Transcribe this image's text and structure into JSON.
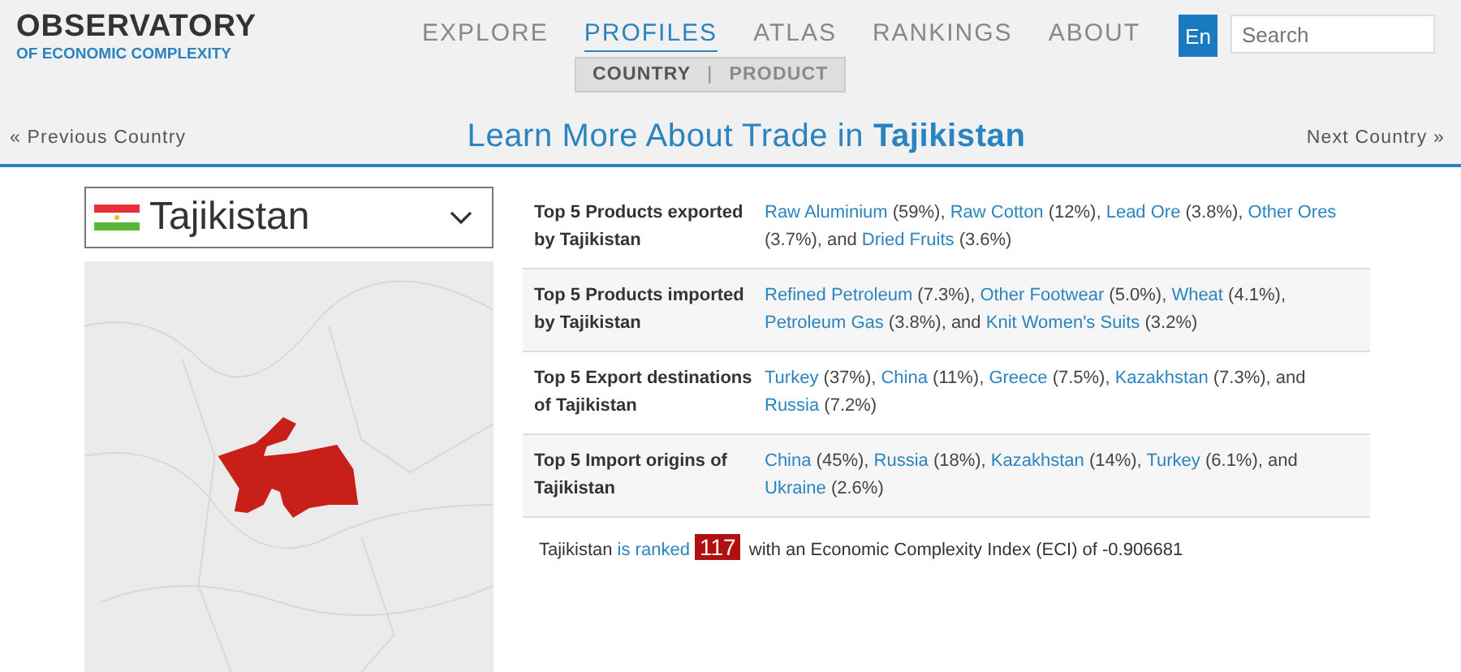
{
  "logo": {
    "title": "OBSERVATORY",
    "subtitle": "OF ECONOMIC COMPLEXITY"
  },
  "nav": [
    {
      "label": "EXPLORE",
      "selected": false
    },
    {
      "label": "PROFILES",
      "selected": true
    },
    {
      "label": "ATLAS",
      "selected": false
    },
    {
      "label": "RANKINGS",
      "selected": false
    },
    {
      "label": "ABOUT",
      "selected": false
    }
  ],
  "subnav": {
    "items": [
      {
        "label": "COUNTRY",
        "selected": true
      },
      {
        "label": "PRODUCT",
        "selected": false
      }
    ],
    "separator": "|"
  },
  "language": "En",
  "search": {
    "placeholder": "Search"
  },
  "prev": "« Previous Country",
  "next": "Next Country »",
  "heading": {
    "text": "Learn More About Trade in ",
    "country": "Tajikistan"
  },
  "country_select": {
    "value": "Tajikistan"
  },
  "rows": [
    {
      "label": "Top 5 Products exported by Tajikistan",
      "parts": [
        {
          "text": "Raw Aluminium",
          "kind": "link"
        },
        {
          "text": " (59%), ",
          "kind": "text"
        },
        {
          "text": "Raw Cotton",
          "kind": "link"
        },
        {
          "text": " (12%), ",
          "kind": "text"
        },
        {
          "text": "Lead Ore",
          "kind": "link"
        },
        {
          "text": " (3.8%), ",
          "kind": "text"
        },
        {
          "text": "Other Ores",
          "kind": "link"
        },
        {
          "text": " (3.7%), and ",
          "kind": "text"
        },
        {
          "text": "Dried Fruits",
          "kind": "link"
        },
        {
          "text": " (3.6%)",
          "kind": "text"
        }
      ]
    },
    {
      "label": "Top 5 Products imported by Tajikistan",
      "parts": [
        {
          "text": "Refined Petroleum",
          "kind": "link"
        },
        {
          "text": " (7.3%), ",
          "kind": "text"
        },
        {
          "text": "Other Footwear",
          "kind": "link"
        },
        {
          "text": " (5.0%), ",
          "kind": "text"
        },
        {
          "text": "Wheat",
          "kind": "link"
        },
        {
          "text": " (4.1%), ",
          "kind": "text"
        },
        {
          "text": "Petroleum Gas",
          "kind": "link"
        },
        {
          "text": " (3.8%), and ",
          "kind": "text"
        },
        {
          "text": "Knit Women's Suits",
          "kind": "link"
        },
        {
          "text": " (3.2%)",
          "kind": "text"
        }
      ]
    },
    {
      "label": "Top 5 Export destinations of Tajikistan",
      "parts": [
        {
          "text": "Turkey",
          "kind": "link"
        },
        {
          "text": " (37%), ",
          "kind": "text"
        },
        {
          "text": "China",
          "kind": "link"
        },
        {
          "text": " (11%), ",
          "kind": "text"
        },
        {
          "text": "Greece",
          "kind": "link"
        },
        {
          "text": " (7.5%), ",
          "kind": "text"
        },
        {
          "text": "Kazakhstan",
          "kind": "link"
        },
        {
          "text": " (7.3%), and ",
          "kind": "text"
        },
        {
          "text": "Russia",
          "kind": "link"
        },
        {
          "text": " (7.2%)",
          "kind": "text"
        }
      ]
    },
    {
      "label": "Top 5 Import origins of Tajikistan",
      "parts": [
        {
          "text": "China",
          "kind": "link"
        },
        {
          "text": " (45%), ",
          "kind": "text"
        },
        {
          "text": "Russia",
          "kind": "link"
        },
        {
          "text": " (18%), ",
          "kind": "text"
        },
        {
          "text": "Kazakhstan",
          "kind": "link"
        },
        {
          "text": " (14%), ",
          "kind": "text"
        },
        {
          "text": "Turkey",
          "kind": "link"
        },
        {
          "text": " (6.1%), and ",
          "kind": "text"
        },
        {
          "text": "Ukraine",
          "kind": "link"
        },
        {
          "text": " (2.6%)",
          "kind": "text"
        }
      ]
    }
  ],
  "ranking": {
    "before": "Tajikistan ",
    "link": "is ranked",
    "rank": "117",
    "after": " with an Economic Complexity Index (ECI) of -0.906681"
  }
}
